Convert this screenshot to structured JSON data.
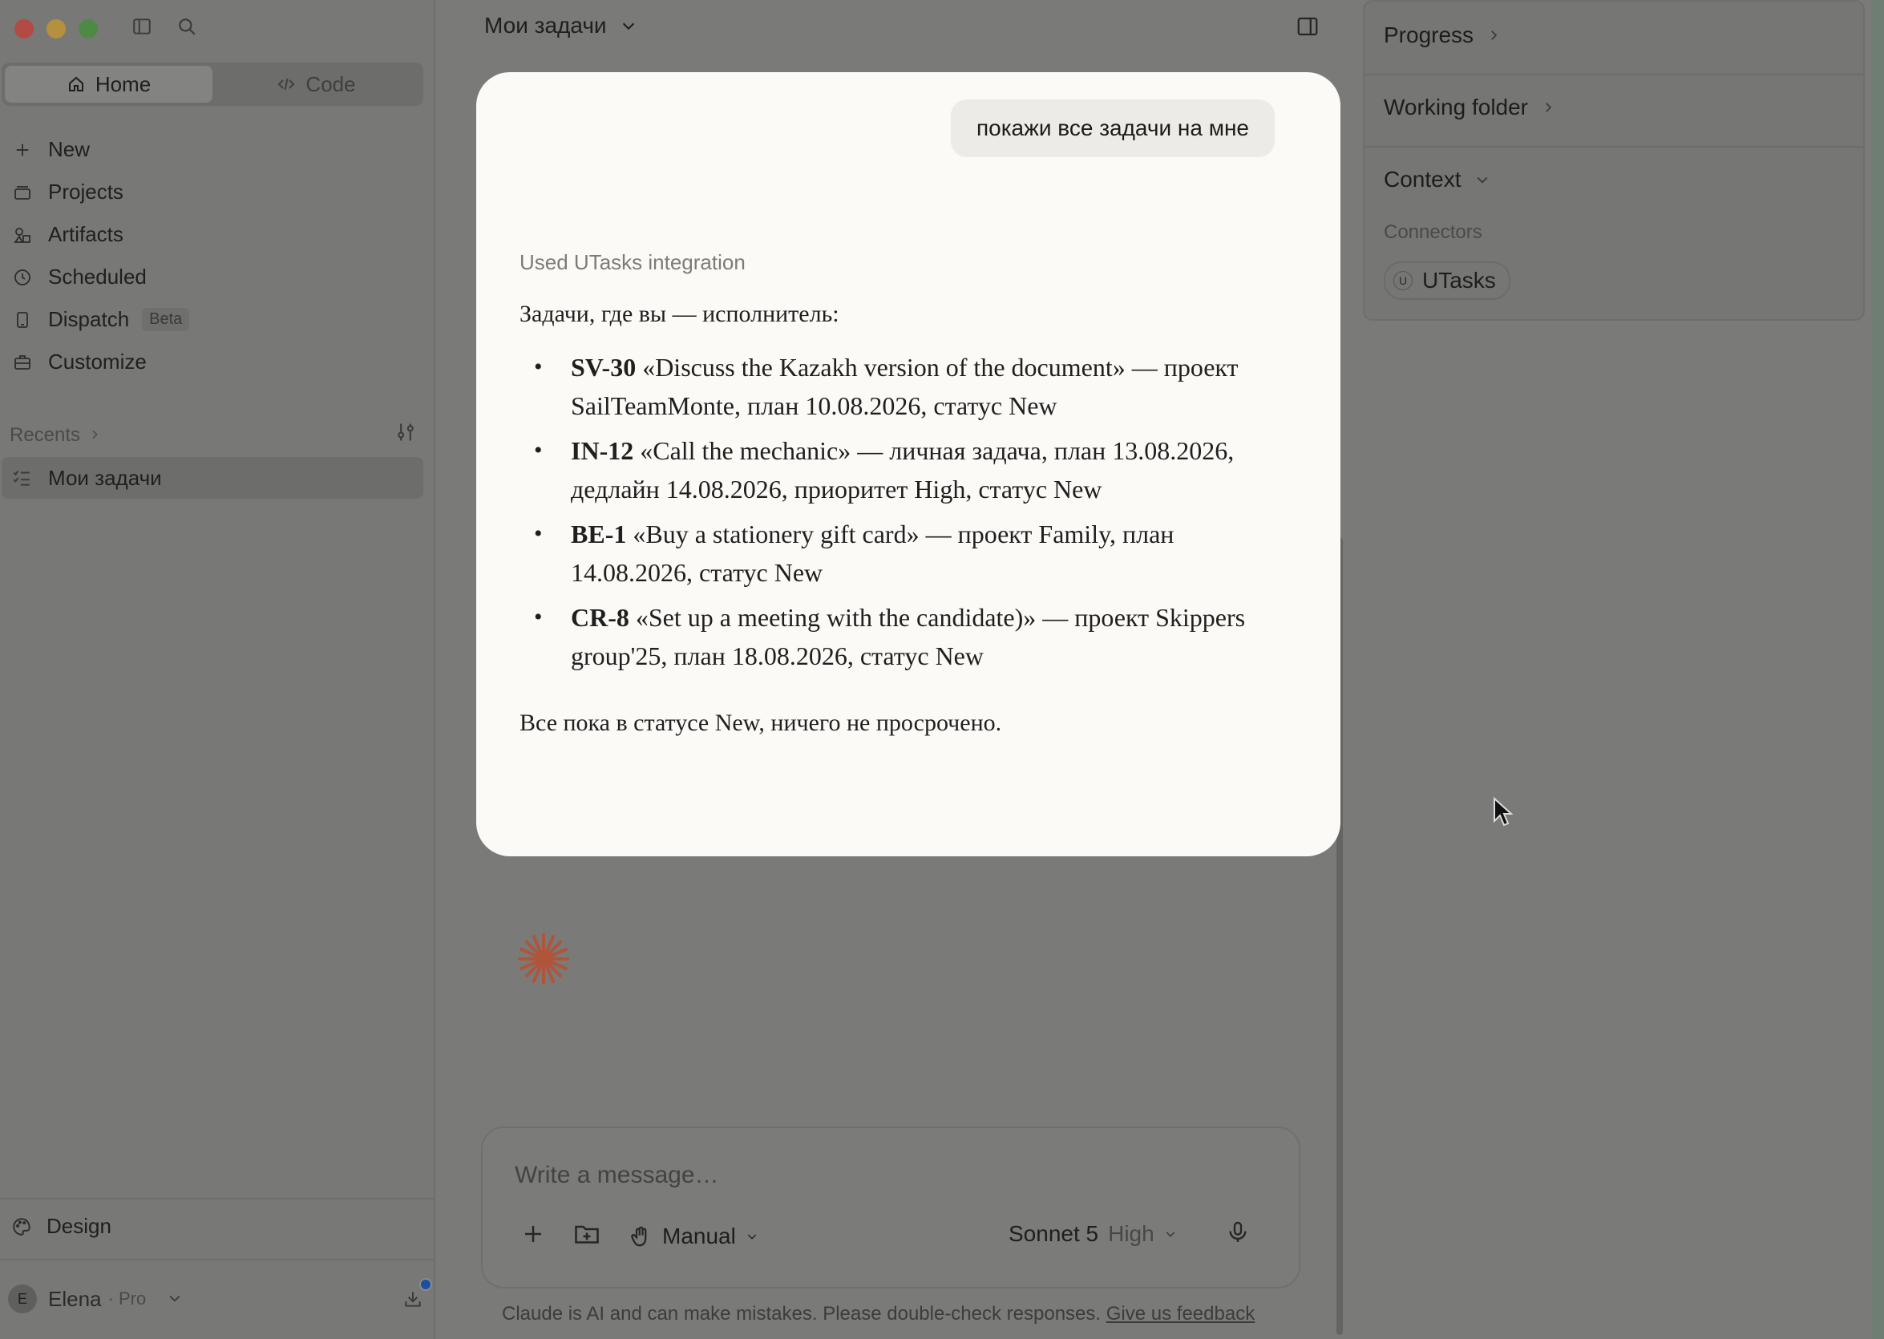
{
  "sidebar": {
    "modes": [
      "Home",
      "Code"
    ],
    "nav": [
      {
        "label": "New",
        "icon": "plus-icon"
      },
      {
        "label": "Projects",
        "icon": "projects-icon"
      },
      {
        "label": "Artifacts",
        "icon": "artifacts-icon"
      },
      {
        "label": "Scheduled",
        "icon": "clock-icon"
      },
      {
        "label": "Dispatch",
        "icon": "phone-icon",
        "badge": "Beta"
      },
      {
        "label": "Customize",
        "icon": "briefcase-icon"
      }
    ],
    "recents_label": "Recents",
    "recents": [
      "Мои задачи"
    ],
    "design_label": "Design",
    "user": {
      "initial": "E",
      "name": "Elena",
      "plan": "· Pro"
    }
  },
  "header": {
    "title": "Мои задачи"
  },
  "conversation": {
    "user_message": "покажи все задачи на мне",
    "tool_used": "Used UTasks integration",
    "intro": "Задачи, где вы — исполнитель:",
    "tasks": [
      {
        "id": "SV-30",
        "text": " «Discuss the Kazakh version of the document» — проект SailTeamMonte, план 10.08.2026, статус New"
      },
      {
        "id": "IN-12",
        "text": " «Call the mechanic» — личная задача, план 13.08.2026, дедлайн 14.08.2026, приоритет High, статус New"
      },
      {
        "id": "BE-1",
        "text": " «Buy a stationery gift card» — проект Family, план 14.08.2026, статус New"
      },
      {
        "id": "CR-8",
        "text": " «Set up a meeting with the candidate)» — проект Skippers group'25, план 18.08.2026, статус New"
      }
    ],
    "outro": "Все пока в статусе New, ничего не просрочено."
  },
  "composer": {
    "placeholder": "Write a message…",
    "mode": "Manual",
    "model": "Sonnet 5",
    "effort": "High"
  },
  "footer": {
    "disclaimer": "Claude is AI and can make mistakes. Please double-check responses.",
    "feedback_link": "Give us feedback"
  },
  "right_panel": {
    "progress": "Progress",
    "working_folder": "Working folder",
    "context": "Context",
    "connectors_label": "Connectors",
    "connectors": [
      {
        "initial": "U",
        "name": "UTasks"
      }
    ]
  },
  "colors": {
    "accent_spinner": "#b0543a",
    "card_bg": "#fbfaf7",
    "overlay_bg": "#7a7a79"
  }
}
